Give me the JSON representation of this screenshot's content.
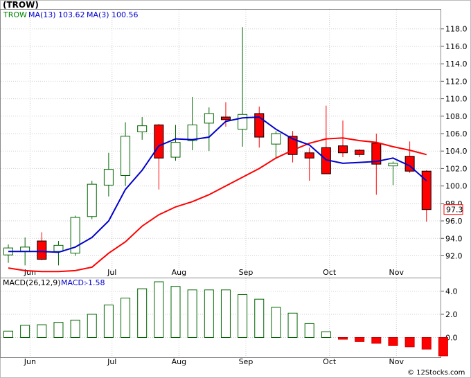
{
  "header": {
    "title": "(TROW)",
    "watermark": "© 12Stocks.com"
  },
  "legend": {
    "symbol": "TROW",
    "ma13_label": "MA(13)",
    "ma13_value": "103.62",
    "ma3_label": "MA(3)",
    "ma3_value": "100.56",
    "macd_params": "MACD(26,12,9)",
    "macd_label": "MACD:",
    "macd_value": "-1.58"
  },
  "colors": {
    "up": "#006400",
    "down": "#ff0000",
    "ma13": "#ff0000",
    "ma3": "#0000cc",
    "symbol": "#008000",
    "legend_blue": "#0000cc",
    "grid": "#cfcfcf"
  },
  "chart_data": [
    {
      "type": "candlestick",
      "panel": "price",
      "ylim": [
        89.5,
        120.2
      ],
      "yticks": [
        92,
        94,
        96,
        98,
        100,
        102,
        104,
        106,
        108,
        110,
        112,
        114,
        116,
        118
      ],
      "xlabels": [
        {
          "label": "Jun",
          "at": 1.3
        },
        {
          "label": "Jul",
          "at": 6.2
        },
        {
          "label": "Aug",
          "at": 10.2
        },
        {
          "label": "Sep",
          "at": 14.2
        },
        {
          "label": "Oct",
          "at": 19.2
        },
        {
          "label": "Nov",
          "at": 23.2
        }
      ],
      "last_price": "97.3",
      "candles": [
        {
          "o": 92.1,
          "h": 93.3,
          "l": 91.2,
          "c": 92.9
        },
        {
          "o": 92.5,
          "h": 94.1,
          "l": 90.9,
          "c": 93.0
        },
        {
          "o": 93.7,
          "h": 94.7,
          "l": 91.5,
          "c": 91.6
        },
        {
          "o": 92.5,
          "h": 93.7,
          "l": 90.9,
          "c": 93.2
        },
        {
          "o": 92.3,
          "h": 96.6,
          "l": 92.0,
          "c": 96.4
        },
        {
          "o": 96.5,
          "h": 100.6,
          "l": 96.2,
          "c": 100.2
        },
        {
          "o": 100.1,
          "h": 103.8,
          "l": 98.8,
          "c": 101.9
        },
        {
          "o": 101.2,
          "h": 107.3,
          "l": 100.0,
          "c": 105.7
        },
        {
          "o": 106.2,
          "h": 107.9,
          "l": 105.3,
          "c": 106.9
        },
        {
          "o": 107.0,
          "h": 107.1,
          "l": 99.6,
          "c": 103.2
        },
        {
          "o": 103.3,
          "h": 107.0,
          "l": 102.9,
          "c": 105.0
        },
        {
          "o": 105.2,
          "h": 110.2,
          "l": 104.1,
          "c": 107.0
        },
        {
          "o": 107.2,
          "h": 109.0,
          "l": 104.0,
          "c": 108.3
        },
        {
          "o": 107.9,
          "h": 109.6,
          "l": 106.8,
          "c": 107.6
        },
        {
          "o": 106.5,
          "h": 118.2,
          "l": 104.5,
          "c": 108.2
        },
        {
          "o": 108.3,
          "h": 109.1,
          "l": 104.4,
          "c": 105.6
        },
        {
          "o": 104.8,
          "h": 106.3,
          "l": 103.2,
          "c": 106.0
        },
        {
          "o": 105.7,
          "h": 106.3,
          "l": 102.7,
          "c": 103.6
        },
        {
          "o": 103.8,
          "h": 104.4,
          "l": 100.6,
          "c": 103.2
        },
        {
          "o": 104.4,
          "h": 109.2,
          "l": 101.4,
          "c": 101.4
        },
        {
          "o": 104.6,
          "h": 107.5,
          "l": 103.3,
          "c": 103.8
        },
        {
          "o": 104.1,
          "h": 104.2,
          "l": 103.3,
          "c": 103.6
        },
        {
          "o": 104.9,
          "h": 106.0,
          "l": 99.0,
          "c": 102.5
        },
        {
          "o": 102.3,
          "h": 102.8,
          "l": 100.1,
          "c": 102.6
        },
        {
          "o": 103.4,
          "h": 105.1,
          "l": 101.5,
          "c": 101.7
        },
        {
          "o": 101.7,
          "h": 101.8,
          "l": 95.9,
          "c": 97.3
        }
      ],
      "series": [
        {
          "name": "MA(13)",
          "points": [
            [
              0,
              90.6
            ],
            [
              1,
              90.3
            ],
            [
              2,
              90.2
            ],
            [
              3,
              90.2
            ],
            [
              4,
              90.3
            ],
            [
              5,
              90.7
            ],
            [
              6,
              92.3
            ],
            [
              7,
              93.6
            ],
            [
              8,
              95.4
            ],
            [
              9,
              96.7
            ],
            [
              10,
              97.6
            ],
            [
              11,
              98.2
            ],
            [
              12,
              99.0
            ],
            [
              13,
              100.0
            ],
            [
              14,
              101.0
            ],
            [
              15,
              102.0
            ],
            [
              16,
              103.2
            ],
            [
              17,
              104.1
            ],
            [
              18,
              104.9
            ],
            [
              19,
              105.4
            ],
            [
              20,
              105.5
            ],
            [
              21,
              105.2
            ],
            [
              22,
              105.0
            ],
            [
              23,
              104.5
            ],
            [
              24,
              104.1
            ],
            [
              25,
              103.6
            ]
          ]
        },
        {
          "name": "MA(3)",
          "points": [
            [
              0,
              92.5
            ],
            [
              1,
              92.5
            ],
            [
              2,
              92.5
            ],
            [
              3,
              92.4
            ],
            [
              4,
              93.0
            ],
            [
              5,
              94.1
            ],
            [
              6,
              96.0
            ],
            [
              7,
              99.6
            ],
            [
              8,
              101.8
            ],
            [
              9,
              104.6
            ],
            [
              10,
              105.4
            ],
            [
              11,
              105.3
            ],
            [
              12,
              105.6
            ],
            [
              13,
              107.4
            ],
            [
              14,
              107.8
            ],
            [
              15,
              107.9
            ],
            [
              16,
              106.5
            ],
            [
              17,
              105.4
            ],
            [
              18,
              104.7
            ],
            [
              19,
              103.0
            ],
            [
              20,
              102.6
            ],
            [
              21,
              102.7
            ],
            [
              22,
              102.8
            ],
            [
              23,
              103.2
            ],
            [
              24,
              102.3
            ],
            [
              25,
              100.6
            ]
          ]
        }
      ]
    },
    {
      "type": "bar",
      "panel": "macd",
      "ylim": [
        -1.7,
        5.1
      ],
      "yticks": [
        0.0,
        2.0,
        4.0
      ],
      "ytick_labels": [
        "0.0",
        "2.0",
        "4.0"
      ],
      "values": [
        0.55,
        1.05,
        1.1,
        1.3,
        1.5,
        2.0,
        2.8,
        3.4,
        4.2,
        4.8,
        4.4,
        4.1,
        4.1,
        4.1,
        3.7,
        3.3,
        2.6,
        2.1,
        1.2,
        0.5,
        -0.15,
        -0.35,
        -0.5,
        -0.7,
        -0.8,
        -1.0,
        -1.58
      ]
    }
  ]
}
